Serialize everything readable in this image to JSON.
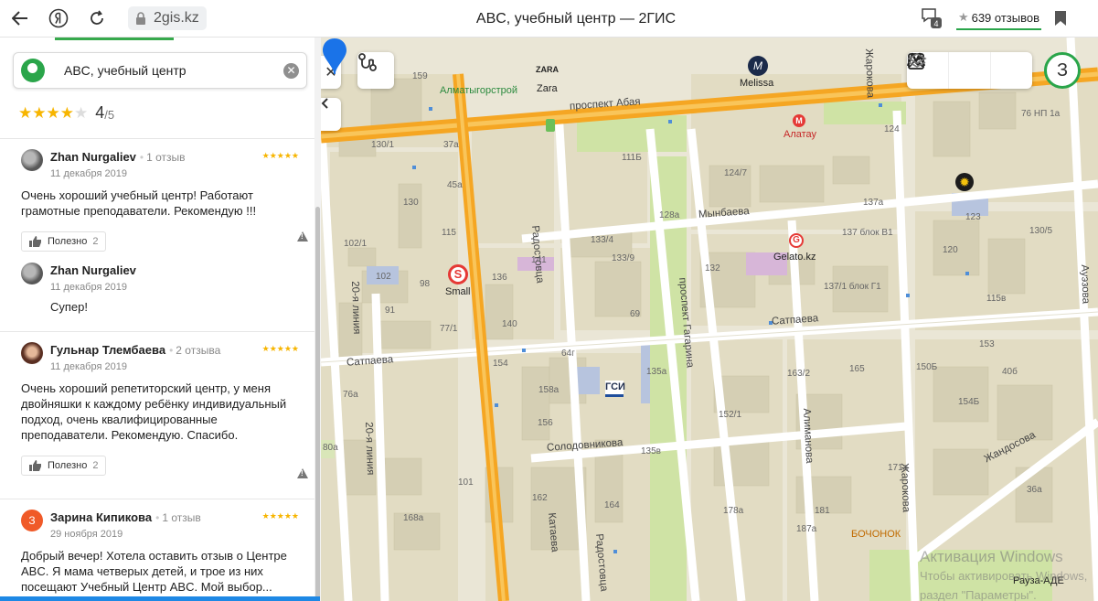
{
  "browser": {
    "url": "2gis.kz",
    "title": "ABC, учебный центр — 2ГИС",
    "tab_badge": "4",
    "reviews_pill": "639 отзывов"
  },
  "panel": {
    "search_value": "ABC, учебный центр",
    "rating": "4",
    "rating_of": "/5",
    "stars_filled": 4,
    "reviews": [
      {
        "name": "Zhan Nurgaliev",
        "count": "1 отзыв",
        "date": "11 декабря 2019",
        "text": "Очень хороший учебный центр! Работают грамотные преподаватели. Рекомендую !!!",
        "useful_label": "Полезно",
        "useful_count": "2",
        "reply_name": "Zhan Nurgaliev",
        "reply_date": "11 декабря 2019",
        "reply_text": "Супер!"
      },
      {
        "name": "Гульнар Тлембаева",
        "count": "2 отзыва",
        "date": "11 декабря 2019",
        "text": "Очень хороший репетиторский центр, у меня двойняшки к каждому ребёнку индивидуальный подход, очень квалифицированные преподаватели. Рекомендую. Спасибо.",
        "useful_label": "Полезно",
        "useful_count": "2"
      },
      {
        "avatar_letter": "З",
        "name": "Зарина Кипикова",
        "count": "1 отзыв",
        "date": "29 ноября 2019",
        "text": "Добрый вечер! Хотела оставить отзыв о Центре ABC. Я мама четверых детей, и трое из них посещают Учебный Центр ABC. Мой выбор..."
      }
    ]
  },
  "map": {
    "user_badge": "З",
    "streets": {
      "abaya": "проспект Абая",
      "satpaeva_left": "Сатпаева",
      "satpaeva_right": "Сатпаева",
      "mynbaeva": "Мынбаева",
      "radostovca_top": "Радостовца",
      "radostovca_bottom": "Радостовца",
      "gagarina": "проспект Гагарина",
      "almanova": "Алиманова",
      "zharokova": "Жарокова",
      "zharokova_top": "Жарокова",
      "solodovnikova": "Солодовникова",
      "kataeva": "Катаева",
      "zhandosova": "Жандосова",
      "line20": "20-я линия",
      "line20_bottom": "20-я линия",
      "auezova": "Ауэзова"
    },
    "pois": {
      "almatygorstroy": "Алматыгорстрой",
      "zara_logo": "ZARA",
      "zara": "Zara",
      "melissa": "Melissa",
      "almaty_metro": "Алатау",
      "small": "Small",
      "gelato": "Gelato.kz",
      "gsi": "ГСИ",
      "bochonok": "БОЧОНОК",
      "rauza": "Рауза-АДЕ"
    },
    "buildings": [
      "159",
      "130/1",
      "37а",
      "45а",
      "115",
      "102/1",
      "102",
      "98",
      "91",
      "77/1",
      "130",
      "136",
      "140",
      "141",
      "133/4",
      "133/9",
      "111Б",
      "124/7",
      "128а",
      "132",
      "69",
      "154",
      "158а",
      "156",
      "162",
      "135а",
      "135в",
      "152/1",
      "163/2",
      "165",
      "150Б",
      "153",
      "154Б",
      "40б",
      "76а",
      "80а",
      "101",
      "168а",
      "164",
      "178а",
      "181",
      "187а",
      "171а",
      "36а",
      "115в",
      "137а",
      "137 блок В1",
      "137/1 блок Г1",
      "124",
      "123",
      "130/5",
      "120",
      "76 НП 1а",
      "64г"
    ],
    "watermark_title": "Активация Windows",
    "watermark_sub1": "Чтобы активировать Windows,",
    "watermark_sub2": "раздел \"Параметры\".",
    "colors": {
      "accent": "#2aa54a",
      "pin": "#1a73e8",
      "road_main": "#f5a623"
    }
  }
}
